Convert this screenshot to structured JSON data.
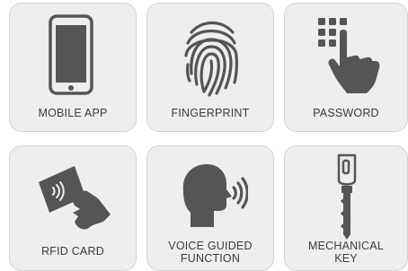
{
  "colors": {
    "tile_background": "#eeeeee",
    "tile_border": "#d3d3d3",
    "icon": "#555555",
    "text": "#3a3a3a"
  },
  "tiles": [
    {
      "icon": "smartphone-icon",
      "label_lines": [
        "MOBILE APP"
      ]
    },
    {
      "icon": "fingerprint-icon",
      "label_lines": [
        "FINGERPRINT"
      ]
    },
    {
      "icon": "keypad-hand-icon",
      "label_lines": [
        "PASSWORD"
      ]
    },
    {
      "icon": "rfid-card-hand-icon",
      "label_lines": [
        "RFID CARD"
      ]
    },
    {
      "icon": "voice-head-icon",
      "label_lines": [
        "VOICE GUIDED",
        "FUNCTION"
      ]
    },
    {
      "icon": "mechanical-key-icon",
      "label_lines": [
        "MECHANICAL",
        "KEY"
      ]
    }
  ]
}
